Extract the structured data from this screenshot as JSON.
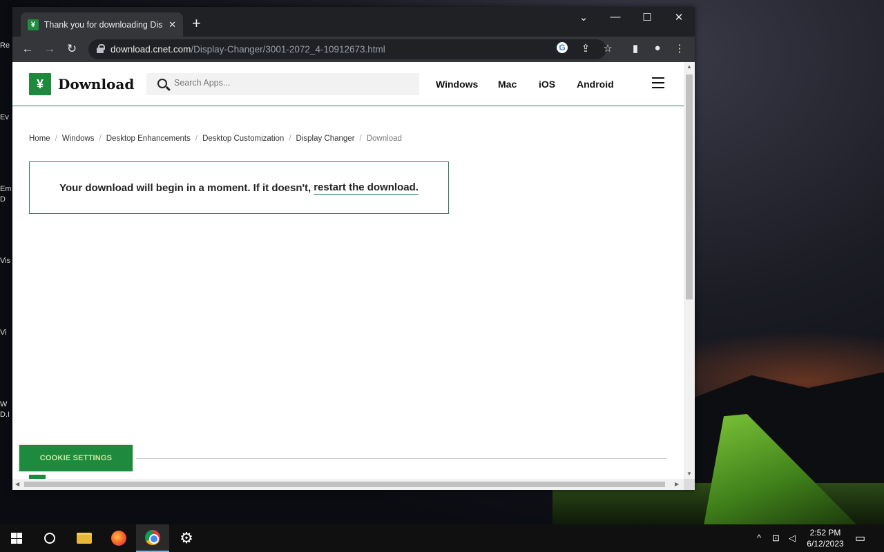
{
  "desktop": {
    "icons": [
      {
        "label": "Re"
      },
      {
        "label": "Ev"
      },
      {
        "label": "Em"
      },
      {
        "label": "D"
      },
      {
        "label": "Vis"
      },
      {
        "label": "Vi"
      },
      {
        "label": "W"
      },
      {
        "label": "D.I"
      }
    ]
  },
  "browser": {
    "tab": {
      "title": "Thank you for downloading Disp",
      "favicon_glyph": "¥",
      "close_glyph": "✕"
    },
    "new_tab_glyph": "+",
    "window_controls": {
      "tab_search": "⌄",
      "minimize": "—",
      "maximize": "☐",
      "close": "✕"
    },
    "nav": {
      "back": "←",
      "forward": "→",
      "reload": "↻"
    },
    "url": {
      "host": "download.cnet.com",
      "path": "/Display-Changer/3001-2072_4-10912673.html"
    },
    "omnibox_icons": {
      "google": "G",
      "share": "⇪",
      "bookmark": "☆",
      "sidepanel": "▮",
      "profile": "●",
      "menu": "⋮"
    }
  },
  "site": {
    "logo_text": "Download",
    "logo_glyph": "¥",
    "search": {
      "placeholder": "Search Apps..."
    },
    "nav": [
      "Windows",
      "Mac",
      "iOS",
      "Android"
    ],
    "breadcrumb": [
      "Home",
      "Windows",
      "Desktop Enhancements",
      "Desktop Customization",
      "Display Changer",
      "Download"
    ],
    "notice": {
      "text": "Your download will begin in a moment. If it doesn't,",
      "link": "restart the download."
    },
    "cookie_button": "COOKIE SETTINGS"
  },
  "taskbar": {
    "clock": {
      "time": "2:52 PM",
      "date": "6/12/2023"
    },
    "tray": {
      "chevron": "^",
      "network": "⊡",
      "volume": "◁"
    },
    "notification_glyph": "▭"
  },
  "colors": {
    "brand_green": "#1e8a3e",
    "accent_border": "#2e7d5b",
    "chrome_dark": "#202124",
    "chrome_toolbar": "#35363a"
  }
}
